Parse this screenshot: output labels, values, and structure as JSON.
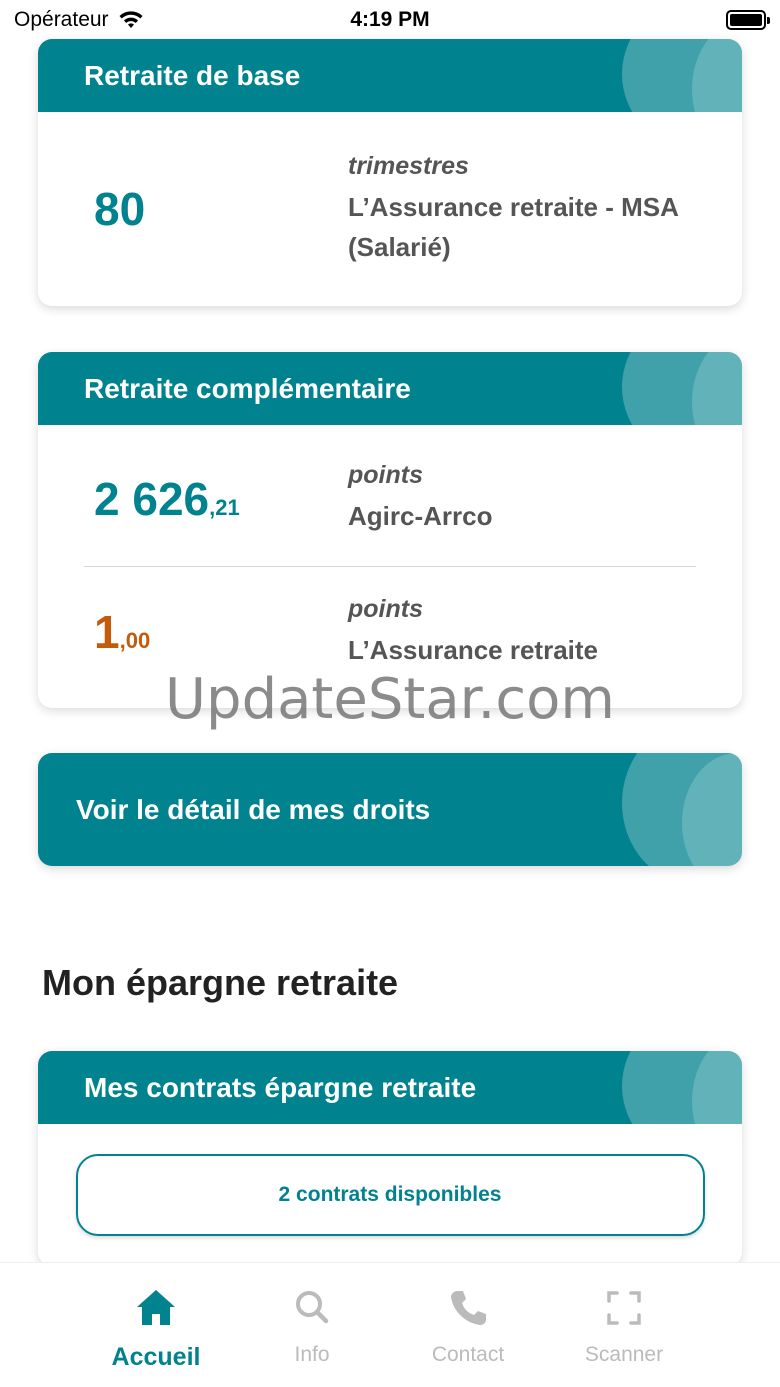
{
  "status_bar": {
    "carrier": "Opérateur",
    "time": "4:19 PM"
  },
  "base": {
    "title": "Retraite de base",
    "value": "80",
    "unit": "trimestres",
    "org_line1": "L’Assurance retraite - MSA",
    "org_line2": "(Salarié)"
  },
  "complementaire": {
    "title": "Retraite complémentaire",
    "rows": [
      {
        "int": "2 626",
        "dec": ",21",
        "unit": "points",
        "org": "Agirc-Arrco"
      },
      {
        "int": "1",
        "dec": ",00",
        "unit": "points",
        "org": "L’Assurance retraite"
      }
    ]
  },
  "detail_button": "Voir le détail de mes droits",
  "epargne": {
    "section_title": "Mon épargne retraite",
    "card_title": "Mes contrats épargne retraite",
    "button": "2 contrats disponibles"
  },
  "watermark": "UpdateStar.com",
  "tabs": [
    {
      "label": "Accueil",
      "icon": "home-icon",
      "active": true
    },
    {
      "label": "Info",
      "icon": "search-icon",
      "active": false
    },
    {
      "label": "Contact",
      "icon": "phone-icon",
      "active": false
    },
    {
      "label": "Scanner",
      "icon": "scan-icon",
      "active": false
    }
  ],
  "colors": {
    "teal": "#00828f",
    "orange": "#c45a0c",
    "inactive": "#bbbbbb"
  }
}
